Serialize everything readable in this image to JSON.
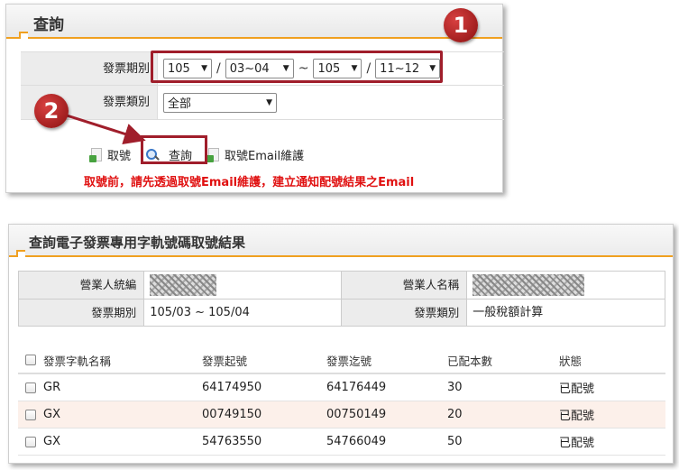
{
  "query_panel": {
    "title": "查詢",
    "period_label": "發票期別",
    "period_start_year": "105",
    "period_start_months": "03~04",
    "period_range_sep": "~",
    "period_end_year": "105",
    "period_end_months": "11~12",
    "slash": "/",
    "type_label": "發票類別",
    "type_value": "全部",
    "actions": {
      "get_number": "取號",
      "query": "查詢",
      "email_maintain": "取號Email維護"
    },
    "warning": "取號前，請先透過取號Email維護，建立通知配號結果之Email",
    "badge1": "1",
    "badge2": "2"
  },
  "result_panel": {
    "title": "查詢電子發票專用字軌號碼取號結果",
    "info": {
      "company_id_label": "營業人統編",
      "company_name_label": "營業人名稱",
      "period_label": "發票期別",
      "period_value": "105/03 ~ 105/04",
      "type_label": "發票類別",
      "type_value": "一般稅額計算"
    },
    "table": {
      "headers": [
        "發票字軌名稱",
        "發票起號",
        "發票迄號",
        "已配本數",
        "狀態"
      ],
      "rows": [
        [
          "GR",
          "64174950",
          "64176449",
          "30",
          "已配號"
        ],
        [
          "GX",
          "00749150",
          "00750149",
          "20",
          "已配號"
        ],
        [
          "GX",
          "54763550",
          "54766049",
          "50",
          "已配號"
        ]
      ]
    }
  },
  "colors": {
    "accent": "#f0a020",
    "highlight": "#a01e2b",
    "warning": "#e01010",
    "row_alt": "#fcf0ea"
  }
}
